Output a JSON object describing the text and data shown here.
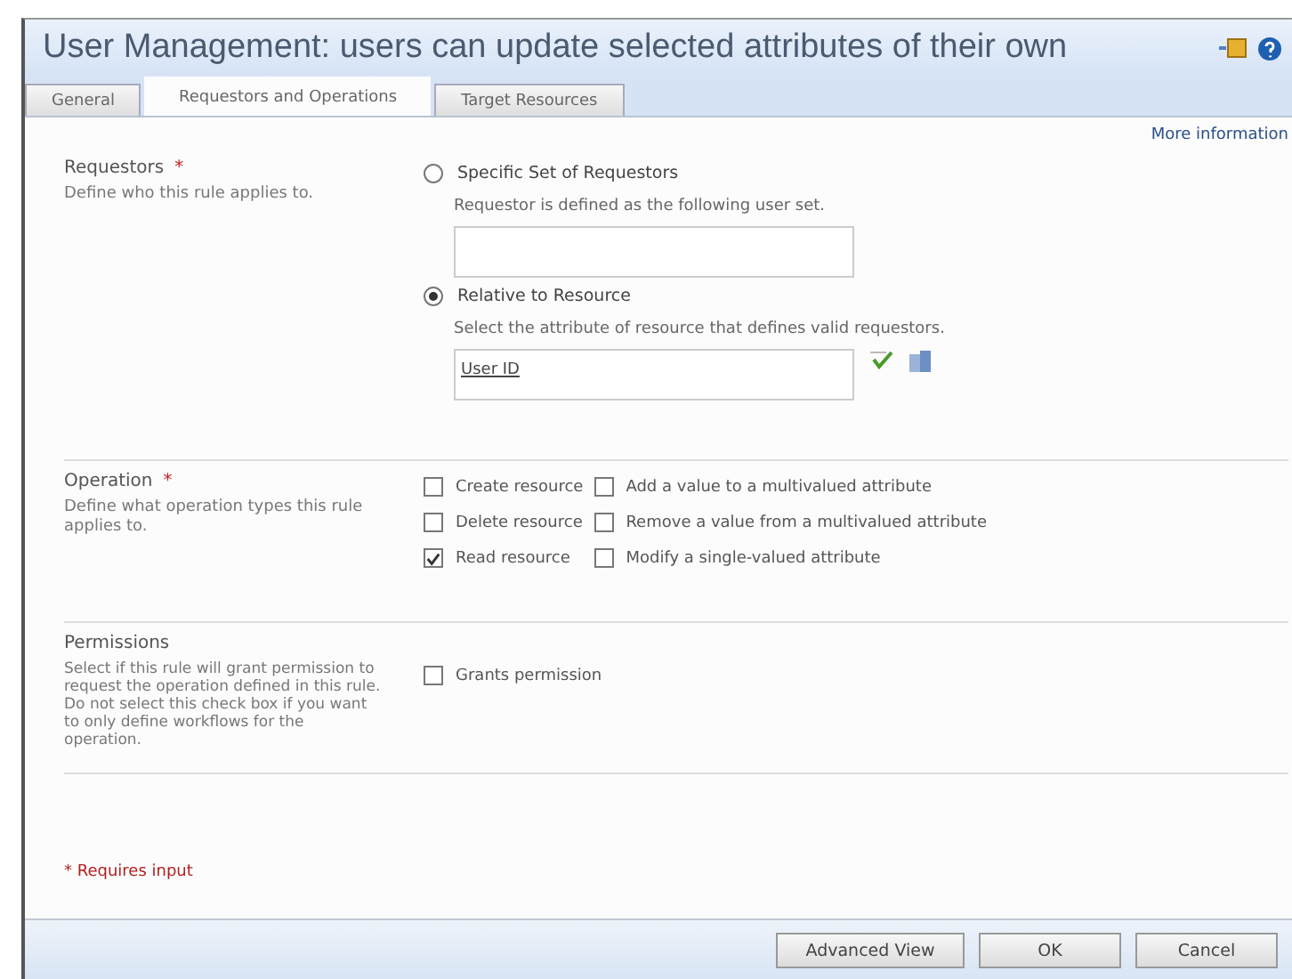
{
  "window": {
    "title": "User Management: users can update selected attributes of their own"
  },
  "tabs": [
    {
      "label": "General",
      "selected": false
    },
    {
      "label": "Requestors and Operations",
      "selected": true
    },
    {
      "label": "Target Resources",
      "selected": false
    }
  ],
  "more_information": "More information",
  "sections": [
    {
      "kind": "requestors",
      "title": "Requestors",
      "required_mark": "*",
      "description": "Define who this rule applies to.",
      "options": [
        {
          "label": "Specific Set of Requestors",
          "selected": false,
          "hint": "Requestor is defined as the following user set."
        },
        {
          "label": "Relative to Resource",
          "selected": true,
          "hint": "Select the attribute of resource that defines valid requestors.",
          "value": "User ID"
        }
      ]
    },
    {
      "kind": "operation",
      "title": "Operation",
      "required_mark": "*",
      "description": "Define what operation types this rule applies to.",
      "checks": [
        {
          "label": "Create resource",
          "checked": false
        },
        {
          "label": "Add a value to a multivalued attribute",
          "checked": false
        },
        {
          "label": "Delete resource",
          "checked": false
        },
        {
          "label": "Remove a value from a multivalued attribute",
          "checked": false
        },
        {
          "label": "Read resource",
          "checked": true
        },
        {
          "label": "Modify a single-valued attribute",
          "checked": false
        }
      ]
    },
    {
      "kind": "permissions",
      "title": "Permissions",
      "description": "Select if this rule will grant permission to request the operation defined in this rule. Do not select this check box if you want to only define workflows for the operation.",
      "checks": [
        {
          "label": "Grants permission",
          "checked": false
        }
      ]
    }
  ],
  "required_note": "* Requires input",
  "buttons": [
    "Advanced View",
    "OK",
    "Cancel"
  ]
}
